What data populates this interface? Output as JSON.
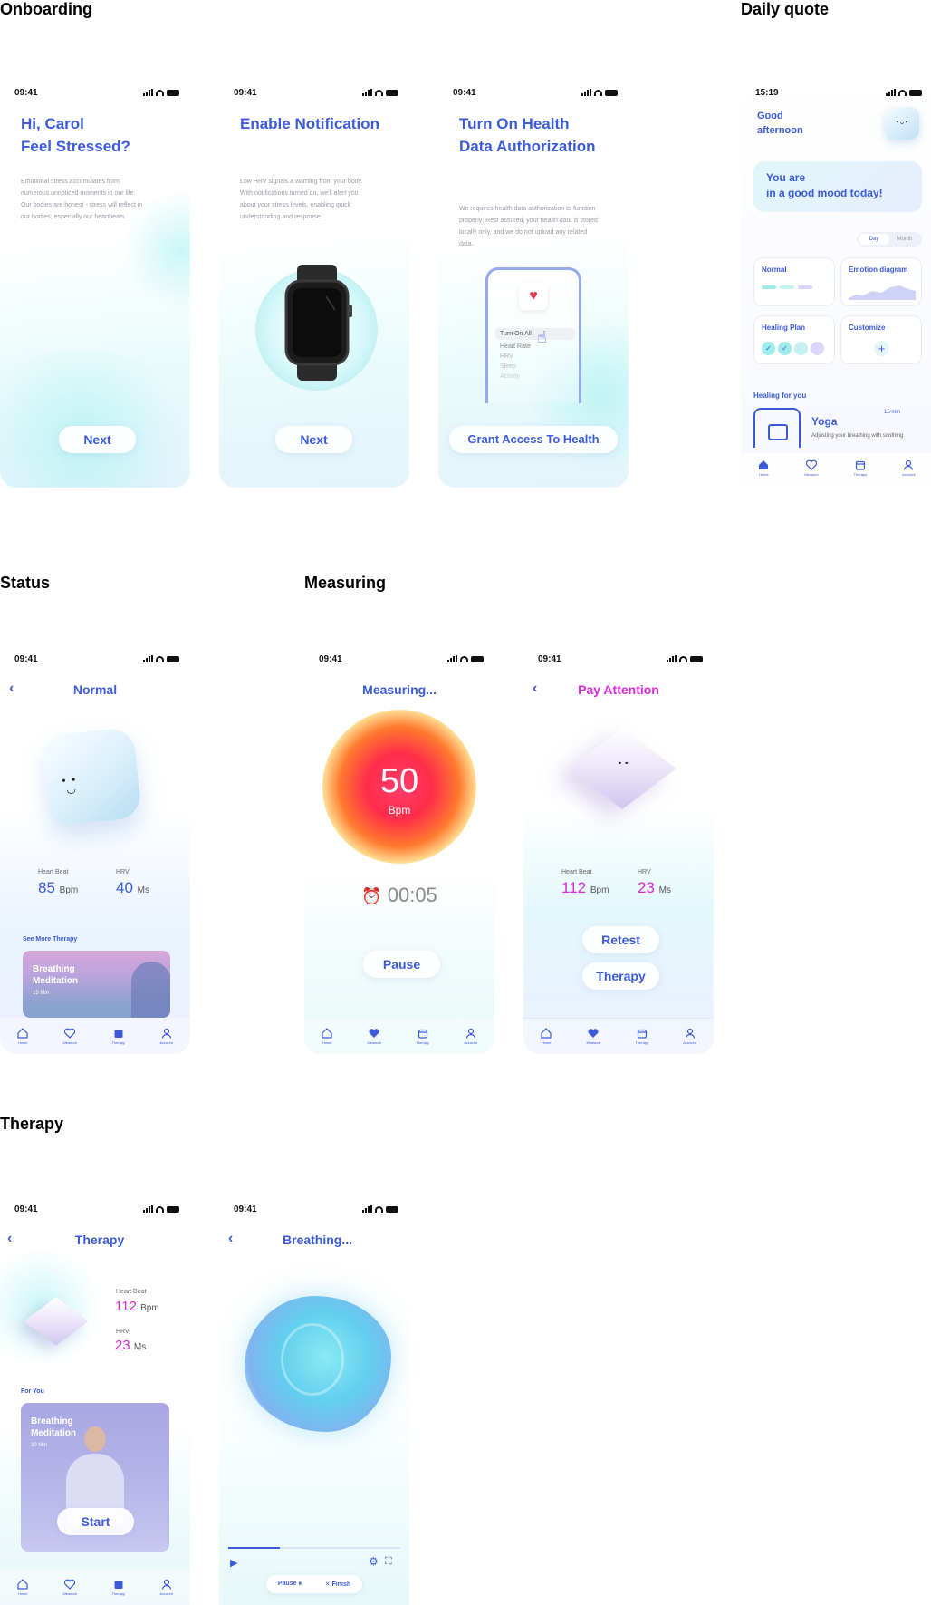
{
  "sections": {
    "onboarding": "Onboarding",
    "daily_quote": "Daily quote",
    "status": "Status",
    "measuring": "Measuring",
    "therapy": "Therapy"
  },
  "time": "09:41",
  "daily_time": "15:19",
  "onboard1": {
    "title_line1": "Hi, Carol",
    "title_line2": "Feel Stressed?",
    "body": "Emotional stress accumulates from numerous unnoticed moments in our life. Our bodies are honest - stress will reflect in our bodies, especially our heartbeats.",
    "button": "Next"
  },
  "onboard2": {
    "title": "Enable Notification",
    "body": "Low HRV signals a warning from your body. With notifications turned on, we'll alert you about your stress levels, enabling quick understanding and response.",
    "button": "Next"
  },
  "onboard3": {
    "title_line1": "Turn On Health",
    "title_line2": "Data Authorization",
    "body": "We requires health data authorization to function properly; Rest assured, your health data is stored locally only, and we do not upload any related data.",
    "list": [
      "Turn On All",
      "Heart Rate",
      "HRV",
      "Sleep",
      "Activity"
    ],
    "button": "Grant Access To Health"
  },
  "daily": {
    "greeting_line1": "Good",
    "greeting_line2": "afternoon",
    "mood_line1": "You are",
    "mood_line2": "in a good mood today!",
    "toggle_day": "Day",
    "toggle_month": "Month",
    "card_normal": "Normal",
    "card_emotion": "Emotion diagram",
    "card_healing": "Healing Plan",
    "card_customize": "Customize",
    "healing_for_you": "Healing for you",
    "yoga_title": "Yoga",
    "yoga_desc": "Adjusting your breathing with soothing",
    "yoga_time": "15 min"
  },
  "tabs": {
    "home": "Home",
    "measure": "Measure",
    "therapy": "Therapy",
    "account": "Account"
  },
  "status": {
    "title": "Normal",
    "hb_label": "Heart Beat",
    "hb_value": "85",
    "hb_unit": "Bpm",
    "hrv_label": "HRV",
    "hrv_value": "40",
    "hrv_unit": "Ms",
    "see_more": "See More Therapy",
    "card_line1": "Breathing",
    "card_line2": "Meditation",
    "card_time": "15 Min"
  },
  "measuring": {
    "title": "Measuring...",
    "bpm": "50",
    "bpm_unit": "Bpm",
    "timer": "00:05",
    "button": "Pause"
  },
  "attention": {
    "title": "Pay Attention",
    "hb_label": "Heart Beat",
    "hb_value": "112",
    "hb_unit": "Bpm",
    "hrv_label": "HRV",
    "hrv_value": "23",
    "hrv_unit": "Ms",
    "retest": "Retest",
    "therapy": "Therapy"
  },
  "therapy": {
    "title": "Therapy",
    "hb_label": "Heart Beat",
    "hb_value": "112",
    "hb_unit": "Bpm",
    "hrv_label": "HRV",
    "hrv_value": "23",
    "hrv_unit": "Ms",
    "for_you": "For You",
    "card_line1": "Breathing",
    "card_line2": "Meditation",
    "card_time": "30 Min",
    "start": "Start"
  },
  "breathing": {
    "title": "Breathing...",
    "pause": "Pause",
    "finish": "Finish",
    "progress": 0.3
  },
  "colors": {
    "accent": "#3b5bd9",
    "pink": "#d62bd6",
    "cyan": "#9ff0f0"
  }
}
